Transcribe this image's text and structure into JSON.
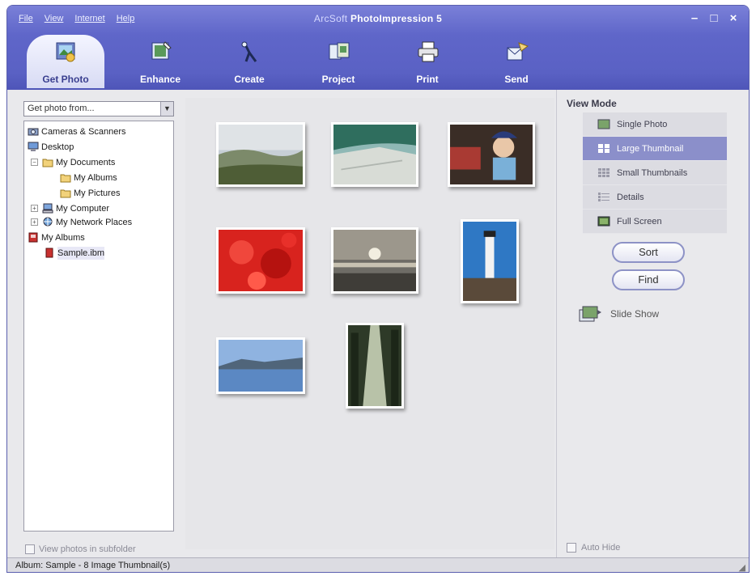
{
  "window": {
    "title_prefix": "ArcSoft",
    "title_main": "PhotoImpression 5",
    "controls": [
      "–",
      "□",
      "×"
    ]
  },
  "menu": [
    "File",
    "View",
    "Internet",
    "Help"
  ],
  "toolbar": {
    "tools": [
      {
        "label": "Get Photo",
        "icon": "get-photo-icon",
        "active": true
      },
      {
        "label": "Enhance",
        "icon": "enhance-icon"
      },
      {
        "label": "Create",
        "icon": "create-icon"
      },
      {
        "label": "Project",
        "icon": "project-icon"
      },
      {
        "label": "Print",
        "icon": "printer-icon"
      },
      {
        "label": "Send",
        "icon": "send-icon"
      }
    ]
  },
  "left_panel": {
    "source_select": "Get photo from...",
    "tree": [
      {
        "label": "Cameras & Scanners",
        "icon": "camera-scanner-icon"
      },
      {
        "label": "Desktop",
        "icon": "desktop-icon"
      },
      {
        "label": "My Documents",
        "icon": "folder-icon"
      },
      {
        "label": "My Albums",
        "icon": "folder-icon"
      },
      {
        "label": "My Pictures",
        "icon": "folder-icon"
      },
      {
        "label": "My Computer",
        "icon": "computer-icon"
      },
      {
        "label": "My Network Places",
        "icon": "network-icon"
      },
      {
        "label": "My Albums",
        "icon": "album-icon"
      },
      {
        "label": "Sample.ibm",
        "icon": "album-file-icon",
        "selected": true
      }
    ],
    "subfolder_checkbox": "View photos in subfolder"
  },
  "gallery": {
    "photos": [
      {
        "name": "landscape-hills"
      },
      {
        "name": "beach-shore"
      },
      {
        "name": "child-portrait"
      },
      {
        "name": "red-flower"
      },
      {
        "name": "sunset-sea"
      },
      {
        "name": "lighthouse"
      },
      {
        "name": "lake-mountains"
      },
      {
        "name": "forest-path"
      }
    ]
  },
  "right_panel": {
    "view_mode_title": "View Mode",
    "view_modes": [
      {
        "label": "Single Photo",
        "icon": "single-photo-icon"
      },
      {
        "label": "Large Thumbnail",
        "icon": "large-thumbnail-icon",
        "selected": true
      },
      {
        "label": "Small Thumbnails",
        "icon": "small-thumbnails-icon"
      },
      {
        "label": "Details",
        "icon": "details-icon"
      },
      {
        "label": "Full Screen",
        "icon": "full-screen-icon"
      }
    ],
    "sort_label": "Sort",
    "find_label": "Find",
    "slideshow_label": "Slide Show",
    "autohide_label": "Auto Hide"
  },
  "status_bar": {
    "text": "Album: Sample - 8 Image Thumbnail(s)"
  },
  "colors": {
    "toolbar_blue": "#5f66c9",
    "selection": "#8b8fca"
  }
}
